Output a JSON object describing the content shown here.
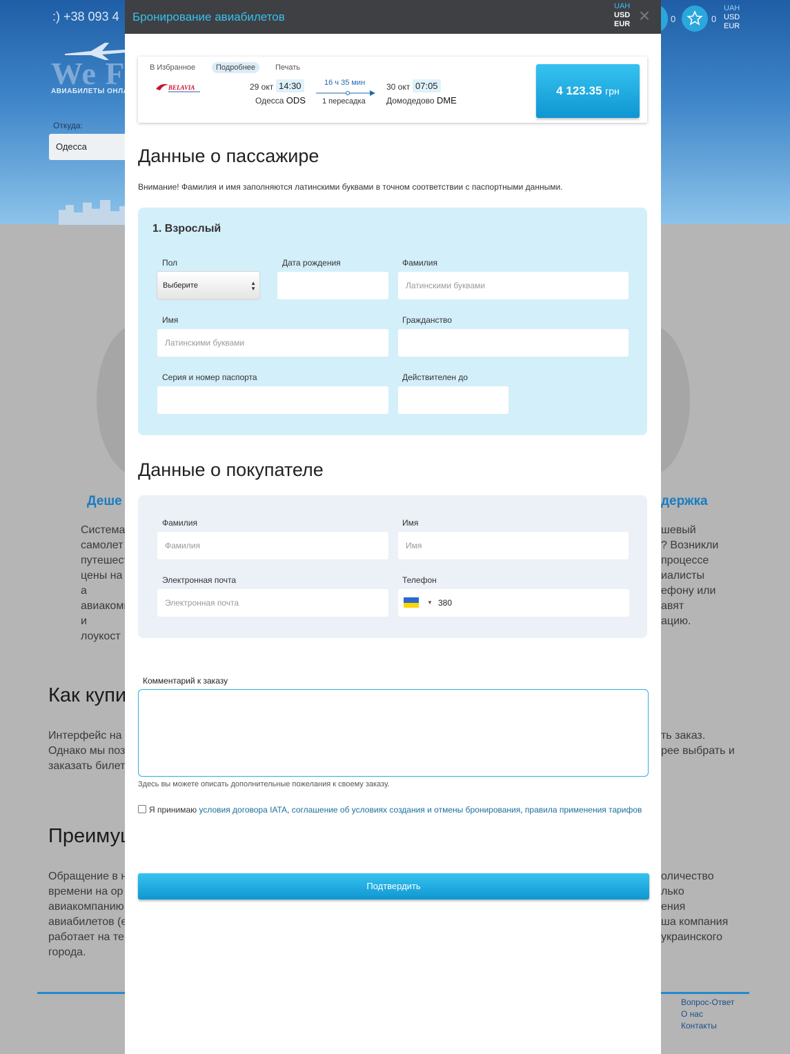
{
  "background": {
    "phone": ":) +38 093 4",
    "logo": "We F",
    "logo_sub": "АВИАБИЛЕТЫ ОНЛАЙ",
    "from_label": "Откуда:",
    "from_value": "Одесса",
    "counts": [
      "0",
      "0"
    ],
    "currencies": [
      "UAH",
      "USD",
      "EUR"
    ],
    "left_heading": "Деше",
    "right_heading": "держка",
    "left_lines": [
      "Система",
      "самолет",
      "путешест",
      "цены на а",
      "авиакомп",
      "и лоукост"
    ],
    "right_lines": [
      "шевый",
      "? Возникли",
      "процессе",
      "иалисты",
      "ефону или",
      "авят",
      "ацию."
    ],
    "h2_buy": "Как купи",
    "buy_left_lines": [
      "Интерфейс на",
      "Однако мы поз",
      "заказать билет"
    ],
    "buy_right_lines": [
      "ть заказ.",
      "рее выбрать и"
    ],
    "h2_adv": "Преимущ",
    "adv_left_lines": [
      "Обращение в н",
      "времени на ор",
      "авиакомпанию",
      "авиабилетов (е",
      "работает на те",
      "города."
    ],
    "adv_right_lines": [
      "оличество",
      "лько",
      "ения",
      "ша компания",
      "украинского"
    ],
    "footer_links": [
      "Вопрос-Ответ",
      "О нас",
      "Контакты"
    ]
  },
  "modal": {
    "title": "Бронирование авиабилетов",
    "currencies": [
      {
        "label": "UAH",
        "selected": true
      },
      {
        "label": "USD",
        "selected": false
      },
      {
        "label": "EUR",
        "selected": false
      }
    ],
    "close": "×"
  },
  "flight": {
    "links": [
      "В Избранное",
      "Подробнее",
      "Печать"
    ],
    "airline": "BELAVIA",
    "depart_date": "29 окт",
    "depart_time": "14:30",
    "depart_city": "Одесса",
    "depart_code": "ODS",
    "duration": "16 ч 35 мин",
    "stops": "1 пересадка",
    "arrive_date": "30 окт",
    "arrive_time": "07:05",
    "arrive_city": "Домодедово",
    "arrive_code": "DME",
    "price": "4 123.35",
    "price_currency": "грн"
  },
  "passenger": {
    "section_title": "Данные о пассажире",
    "notice": "Внимание! Фамилия и имя заполняются латинскими буквами в точном соответствии с паспортными данными.",
    "panel_title": "1. Взрослый",
    "gender_label": "Пол",
    "gender_value": "Выберите",
    "birth_label": "Дата рождения",
    "surname_label": "Фамилия",
    "surname_placeholder": "Латинскими буквами",
    "name_label": "Имя",
    "name_placeholder": "Латинскими буквами",
    "citizenship_label": "Гражданство",
    "passport_label": "Серия и номер паспорта",
    "valid_label": "Действителен до"
  },
  "buyer": {
    "section_title": "Данные о покупателе",
    "surname_label": "Фамилия",
    "surname_placeholder": "Фамилия",
    "name_label": "Имя",
    "name_placeholder": "Имя",
    "email_label": "Электронная почта",
    "email_placeholder": "Электронная почта",
    "phone_label": "Телефон",
    "phone_code": "380"
  },
  "comment": {
    "label": "Комментарий к заказу",
    "hint": "Здесь вы можете описать дополнительные пожелания к своему заказу."
  },
  "agree": {
    "prefix": "Я принимаю ",
    "link1": "условия договора IATA",
    "sep1": ", ",
    "link2": "соглашение об условиях создания и отмены бронирования",
    "sep2": ", ",
    "link3": "правила применения тарифов"
  },
  "confirm_label": "Подтвердить",
  "colors": {
    "accent": "#36c0f0",
    "header": "#3f4043",
    "passenger_panel": "#d3effa",
    "buyer_panel": "#ebf1f6"
  }
}
